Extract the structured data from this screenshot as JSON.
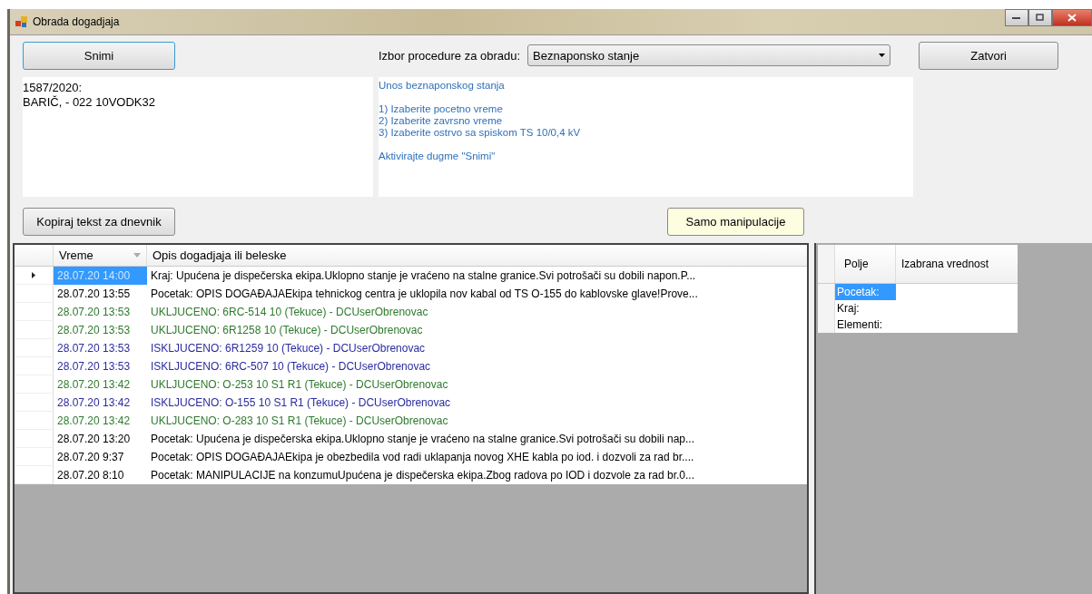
{
  "window": {
    "title": "Obrada dogadjaja"
  },
  "save_button": "Snimi",
  "procedure_label": "Izbor procedure za obradu:",
  "procedure_select": {
    "value": "Beznaponsko stanje"
  },
  "close_button": "Zatvori",
  "case_text": [
    "1587/2020:",
    "BARIČ, - 022 10VODK32"
  ],
  "instructions": [
    [
      "Unos beznaponskog stanja"
    ],
    [
      "1) Izaberite pocetno vreme",
      "2) Izaberite zavrsno vreme",
      "3) Izaberite ostrvo sa spiskom TS 10/0,4 kV"
    ],
    [
      "Aktivirajte dugme \"Snimi\""
    ]
  ],
  "copy_button": "Kopiraj tekst za dnevnik",
  "manipulations_button": "Samo manipulacije",
  "events": {
    "columns": [
      "Vreme",
      "Opis dogadjaja ili beleske"
    ],
    "rows": [
      {
        "time": "28.07.20 14:00",
        "description": "Kraj: Upućena je dispečerska ekipa.Uklopno stanje je vraćeno na stalne granice.Svi potrošači su dobili napon.P...",
        "color": "#000000",
        "selected": true
      },
      {
        "time": "28.07.20 13:55",
        "description": "Pocetak: OPIS DOGAĐAJAEkipa tehnickog centra je uklopila nov kabal od TS O-155 do kablovske glave!Prove...",
        "color": "#000000",
        "selected": false
      },
      {
        "time": "28.07.20 13:53",
        "description": "UKLJUCENO: 6RC-514 10 (Tekuce) - DCUserObrenovac",
        "color": "#2e7a2e",
        "selected": false
      },
      {
        "time": "28.07.20 13:53",
        "description": "UKLJUCENO: 6R1258 10 (Tekuce) - DCUserObrenovac",
        "color": "#2e7a2e",
        "selected": false
      },
      {
        "time": "28.07.20 13:53",
        "description": "ISKLJUCENO: 6R1259 10 (Tekuce) - DCUserObrenovac",
        "color": "#2b2ba0",
        "selected": false
      },
      {
        "time": "28.07.20 13:53",
        "description": "ISKLJUCENO: 6RC-507 10 (Tekuce) - DCUserObrenovac",
        "color": "#2b2ba0",
        "selected": false
      },
      {
        "time": "28.07.20 13:42",
        "description": "UKLJUCENO: O-253 10 S1 R1 (Tekuce) - DCUserObrenovac",
        "color": "#2e7a2e",
        "selected": false
      },
      {
        "time": "28.07.20 13:42",
        "description": "ISKLJUCENO: O-155 10 S1 R1 (Tekuce) - DCUserObrenovac",
        "color": "#2b2ba0",
        "selected": false
      },
      {
        "time": "28.07.20 13:42",
        "description": "UKLJUCENO: O-283 10 S1 R1 (Tekuce) - DCUserObrenovac",
        "color": "#2e7a2e",
        "selected": false
      },
      {
        "time": "28.07.20 13:20",
        "description": "Pocetak: Upućena je dispečerska ekipa.Uklopno stanje je vraćeno na stalne granice.Svi potrošači su dobili nap...",
        "color": "#000000",
        "selected": false
      },
      {
        "time": "28.07.20 9:37",
        "description": "Pocetak: OPIS DOGAĐAJAEkipa je obezbedila vod radi uklapanja novog XHE kabla po iod. i dozvoli za rad br....",
        "color": "#000000",
        "selected": false
      },
      {
        "time": "28.07.20 8:10",
        "description": "Pocetak: MANIPULACIJE na konzumuUpućena je dispečerska ekipa.Zbog radova po IOD i dozvole za rad br.0...",
        "color": "#000000",
        "selected": false
      }
    ]
  },
  "fields": {
    "columns": [
      "Polje",
      "Izabrana vrednost"
    ],
    "rows": [
      {
        "field": "Pocetak:",
        "selected": true
      },
      {
        "field": "Kraj:",
        "selected": false
      },
      {
        "field": "Elementi:",
        "selected": false
      }
    ]
  }
}
